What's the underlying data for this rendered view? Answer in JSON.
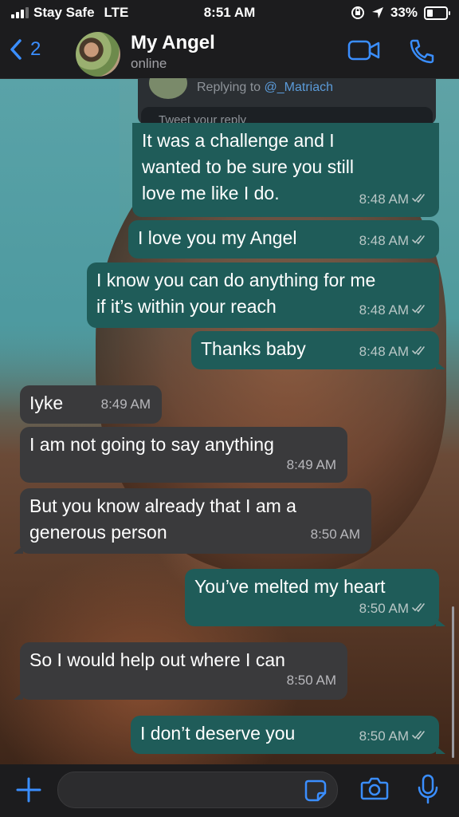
{
  "status_bar": {
    "carrier": "Stay Safe",
    "network": "LTE",
    "time": "8:51 AM",
    "battery": "33%",
    "battery_level": 0.33
  },
  "header": {
    "back_count": "2",
    "contact_name": "My Angel",
    "contact_status": "online",
    "accent_color": "#3a8eff"
  },
  "quoted_tweet": {
    "replying_prefix": "Replying to",
    "replying_handle": "@_Matriach",
    "placeholder": "Tweet your reply"
  },
  "messages": [
    {
      "direction": "out",
      "text": "It was a challenge and I\nwanted to be sure you still\nlove me like I do.",
      "time": "8:48 AM",
      "read": true
    },
    {
      "direction": "out",
      "text": "I love you my Angel",
      "time": "8:48 AM",
      "read": true
    },
    {
      "direction": "out",
      "text": "I know you can do anything for me\nif it’s within your reach",
      "time": "8:48 AM",
      "read": true
    },
    {
      "direction": "out",
      "text": "Thanks baby",
      "time": "8:48 AM",
      "read": true
    },
    {
      "direction": "in",
      "text": "Iyke",
      "time": "8:49 AM"
    },
    {
      "direction": "in",
      "text": "I am not going to say anything",
      "time": "8:49 AM"
    },
    {
      "direction": "in",
      "text": "But you know already that I am a\ngenerous person",
      "time": "8:50 AM"
    },
    {
      "direction": "out",
      "text": "You’ve melted my heart",
      "time": "8:50 AM",
      "read": true
    },
    {
      "direction": "in",
      "text": "So I would help out where I can",
      "time": "8:50 AM"
    },
    {
      "direction": "out",
      "text": "I don’t deserve you",
      "time": "8:50 AM",
      "read": true
    }
  ],
  "input_bar": {
    "icons": [
      "plus-icon",
      "sticker-icon",
      "camera-icon",
      "microphone-icon"
    ]
  },
  "colors": {
    "outgoing_bubble": "#1f5c59",
    "incoming_bubble": "#3a3a3c",
    "bar_background": "#1c1c1e"
  }
}
